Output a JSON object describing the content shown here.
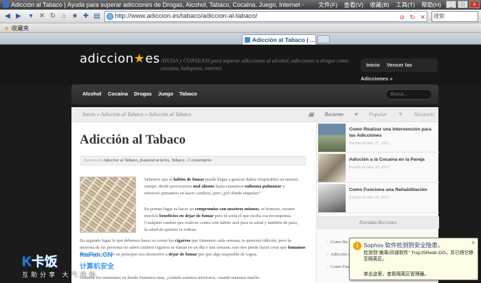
{
  "browser": {
    "window_title": "Adicción al Tabaco | Ayuda para superar adicciones de Drogas, Alcohol, Tabaco, Cocaina, Juego, Internet -",
    "window_menu": [
      "文件(F)",
      "查看(V)",
      "收藏(B)",
      "工具(T)",
      "帮助(H)"
    ],
    "url": "http://www.adiccion.es/tabaco/adiccion-al-tabaco/",
    "search_placeholder": "搜索",
    "favorites_label": "收藏夹",
    "active_tab": "Adicción al Tabaco | ..."
  },
  "site": {
    "logo_prefix": "adiccion",
    "logo_star": "★",
    "logo_suffix": "es",
    "tagline": "AYUDA y CONSEJOS para superar adicciones al alcohol, adicciones a drogas como cocaina, ludopatia, internet",
    "top_nav": [
      "Inicio",
      "Vencer las Adicciones »"
    ],
    "main_nav": [
      "Alcohol",
      "Cocaina",
      "Drogas",
      "Juego",
      "Tabaco"
    ],
    "search_placeholder": "Busca...",
    "breadcrumb": "Inicio » Adiccion al Tabaco » Adicción al Tabaco",
    "side_tabs": [
      "Reciente",
      "Popular",
      "Aleatorio"
    ]
  },
  "article": {
    "title": "Adicción al Tabaco",
    "meta_prefix": "Escrito en",
    "meta_categories": "Adiccion al Tabaco, featured articles, Tabaco",
    "meta_comments": "1 comentario",
    "paragraphs": [
      {
        "a": "Sabemos que el ",
        "b": "hábito de fumar",
        "c": " puede llegar a generar daños irreparables en nuestro cuerpo, desde provocarnos ",
        "d": "mal aliento",
        "e": " hasta causarnos ",
        "f": "enfisema pulmonar",
        "g": " y entonces pensamos en hacer cambios, pero ¿por dónde empezar?"
      },
      {
        "a": "En primer lugar es hacer un ",
        "b": "compromiso con nosotros mismos",
        "c": ", sé honesto, existen muchos ",
        "d": "beneficios en dejar de fumar",
        "e": " pero tú serás el que reciba esa recompensa. Cualquier cambio que realices contra este hábito será para tu salud y también de paso, la salud de quienes te rodean.",
        "f": "",
        "g": ""
      },
      {
        "a": "En segundo lugar lo que debemos hacer es costar los ",
        "b": "cigarros",
        "c": " que fumamos cada semana, te parecerá ridículo, pero la mayoría de las personas no saben cuántos cigarros se fuman en un día o una semana, esto nos puede hacer crear que ",
        "d": "fumamos demasiado",
        "e": " y desde un principio nos desmotive a ",
        "f": "dejar de fumar",
        "g": " por que algo imposible de lograr."
      },
      {
        "a": "Conocer los momentos en donde fumamos más, ¿cuándo estamos nerviosos, cuando tenemos mucho",
        "b": "",
        "c": "",
        "d": "",
        "e": "",
        "f": "",
        "g": ""
      }
    ]
  },
  "sidebar": {
    "posts": [
      {
        "title": "Como Realizar una Intervención para las Adicciones",
        "date": "Escrito en mar 27, 2012"
      },
      {
        "title": "Adicción a la Cocaina en la Pareja",
        "date": "Escrito en mar 26, 2012"
      },
      {
        "title": "Como Funciona una Rehabilitación",
        "date": "Escrito en mar 25, 2012"
      }
    ],
    "recent_heading": "Entradas Recientes",
    "recent_links": [
      "Como Re...",
      "Adicción a...",
      "Como Fun..."
    ]
  },
  "notification": {
    "title": "Sophos 软件检测到安全隐患。",
    "body": "检测到“病毒/间谍软件” Troj/JSRedir-DO，并已将它移至隔离区。",
    "link": "单击这里，查看隔离区管理器。",
    "close": "×"
  },
  "watermark": {
    "logo": "卡饭",
    "logo_k": "K",
    "brand": "KaFan.CN",
    "sub": "计算机安全",
    "slogan": "互助分享  大气谦和"
  },
  "colors": {
    "accent_star": "#f2b30a",
    "header_bg": "#171717",
    "link_blue": "#1d3f8a"
  }
}
